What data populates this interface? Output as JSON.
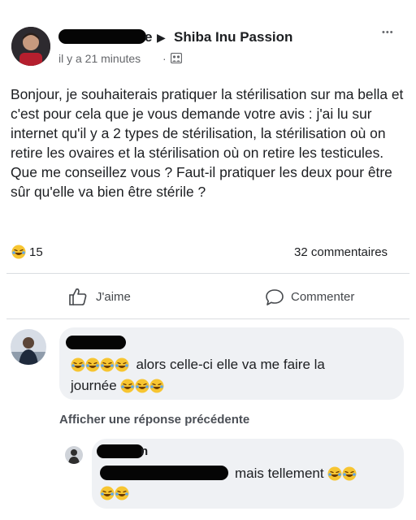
{
  "post": {
    "author_hidden": true,
    "author_suffix": "e",
    "arrow_glyph": "▶",
    "group_name": "Shiba Inu Passion",
    "timestamp": "il y a 21 minutes",
    "separator": "·",
    "audience_icon": "group-audience-icon",
    "more_glyph": "•••",
    "body": "Bonjour, je souhaiterais pratiquer la stérilisation sur ma bella et c'est pour cela que je vous demande votre avis : j'ai lu sur internet qu'il y a 2 types de stérilisation, la stérilisation où on retire les ovaires et la stérilisation où on retire les testicules. Que me conseillez vous ? Faut-il pratiquer les deux pour être sûr qu'elle va bien être stérile ?",
    "reaction_icon": "laughing-tears-emoji",
    "reaction_count": "15",
    "comments_count": "32 commentaires"
  },
  "actions": {
    "like_icon": "thumbs-up-icon",
    "like_label": "J'aime",
    "comment_icon": "comment-bubble-icon",
    "comment_label": "Commenter"
  },
  "comment1": {
    "author_hidden": true,
    "text_a": "alors celle-ci elle va me faire la",
    "text_b": "journée",
    "emoji_before": 4,
    "emoji_after": 3,
    "emoji_icon": "laughing-tears-emoji"
  },
  "show_previous_reply": "Afficher une réponse précédente",
  "reply1": {
    "author_hidden": true,
    "author_suffix": "n",
    "text": "mais tellement",
    "emoji_inline": 2,
    "emoji_next_line": 2,
    "emoji_icon": "laughing-tears-emoji"
  },
  "colors": {
    "text": "#1c1e21",
    "muted": "#65676b",
    "bubble": "#eff1f4",
    "divider": "#dadde1",
    "emoji_face": "#f7c531",
    "emoji_tear": "#5ea6ea"
  }
}
